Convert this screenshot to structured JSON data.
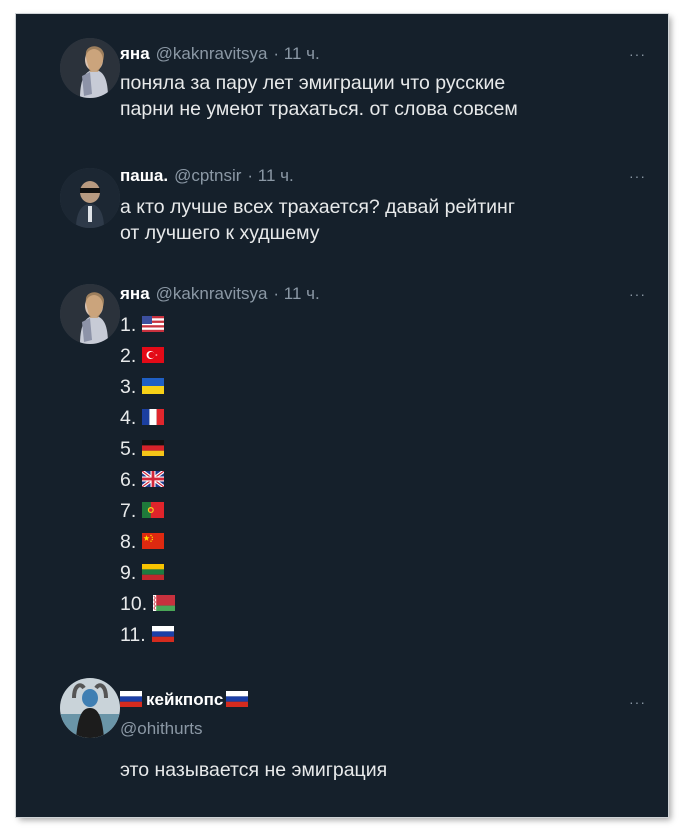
{
  "tweets": [
    {
      "name": "яна",
      "handle": "@kaknravitsya",
      "time": "· 11 ч.",
      "more": "···",
      "text_lines": [
        "поняла за пару лет эмиграции что русские",
        "парни не умеют трахаться. от слова совсем"
      ]
    },
    {
      "name": "паша.",
      "handle": "@cptnsir",
      "time": "· 11 ч.",
      "more": "···",
      "text_lines": [
        "а кто лучше всех трахается? давай рейтинг",
        "от лучшего к худшему"
      ]
    },
    {
      "name": "яна",
      "handle": "@kaknravitsya",
      "time": "· 11 ч.",
      "more": "···",
      "ranking": [
        {
          "label": "1.",
          "flag": "usa-flag"
        },
        {
          "label": "2.",
          "flag": "turkey-flag"
        },
        {
          "label": "3.",
          "flag": "ukraine-flag"
        },
        {
          "label": "4.",
          "flag": "france-flag"
        },
        {
          "label": "5.",
          "flag": "germany-flag"
        },
        {
          "label": "6.",
          "flag": "uk-flag"
        },
        {
          "label": "7.",
          "flag": "portugal-flag"
        },
        {
          "label": "8.",
          "flag": "china-flag"
        },
        {
          "label": "9.",
          "flag": "lithuania-flag"
        },
        {
          "label": "10.",
          "flag": "belarus-flag"
        },
        {
          "label": "11.",
          "flag": "russia-flag"
        }
      ]
    },
    {
      "name": "кейкпопс",
      "name_flags": [
        "russia-flag",
        "russia-flag"
      ],
      "handle": "@ohithurts",
      "more": "···",
      "text_lines": [
        "это называется не эмиграция"
      ]
    }
  ],
  "colors": {
    "background": "#15202b",
    "text": "#e7e9ea",
    "muted": "#8b98a5"
  }
}
